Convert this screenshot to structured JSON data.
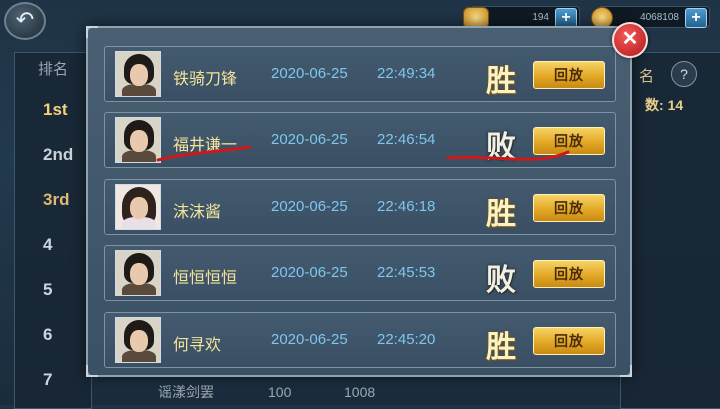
{
  "topbar": {
    "gold_amount": "194",
    "coin_amount": "4068108",
    "back_symbol": "↶",
    "plus_symbol": "+"
  },
  "left_panel": {
    "header": "排名",
    "ranks": [
      "1st",
      "2nd",
      "3rd",
      "4",
      "5",
      "6",
      "7"
    ]
  },
  "right_panel": {
    "header": "名",
    "help_symbol": "?",
    "count_label": "数:",
    "count_value": "14"
  },
  "bottom_row": {
    "name": "谣漾剑罢",
    "value1": "100",
    "value2": "1008"
  },
  "modal": {
    "close_symbol": "✕",
    "records": [
      {
        "name": "铁骑刀锋",
        "date": "2020-06-25",
        "time": "22:49:34",
        "result": "胜",
        "outcome": "win",
        "replay": "回放",
        "avatar": "male"
      },
      {
        "name": "福井谦一",
        "date": "2020-06-25",
        "time": "22:46:54",
        "result": "败",
        "outcome": "lose",
        "replay": "回放",
        "avatar": "male"
      },
      {
        "name": "沫沫酱",
        "date": "2020-06-25",
        "time": "22:46:18",
        "result": "胜",
        "outcome": "win",
        "replay": "回放",
        "avatar": "female"
      },
      {
        "name": "恒恒恒恒",
        "date": "2020-06-25",
        "time": "22:45:53",
        "result": "败",
        "outcome": "lose",
        "replay": "回放",
        "avatar": "male"
      },
      {
        "name": "何寻欢",
        "date": "2020-06-25",
        "time": "22:45:20",
        "result": "胜",
        "outcome": "win",
        "replay": "回放",
        "avatar": "male"
      }
    ]
  },
  "colors": {
    "annotation_underline": "#d01818",
    "win_text": "#fbf3c3",
    "lose_text": "#f3f0e2",
    "name_text": "#f4e39b",
    "datetime_text": "#7fc6ef"
  }
}
